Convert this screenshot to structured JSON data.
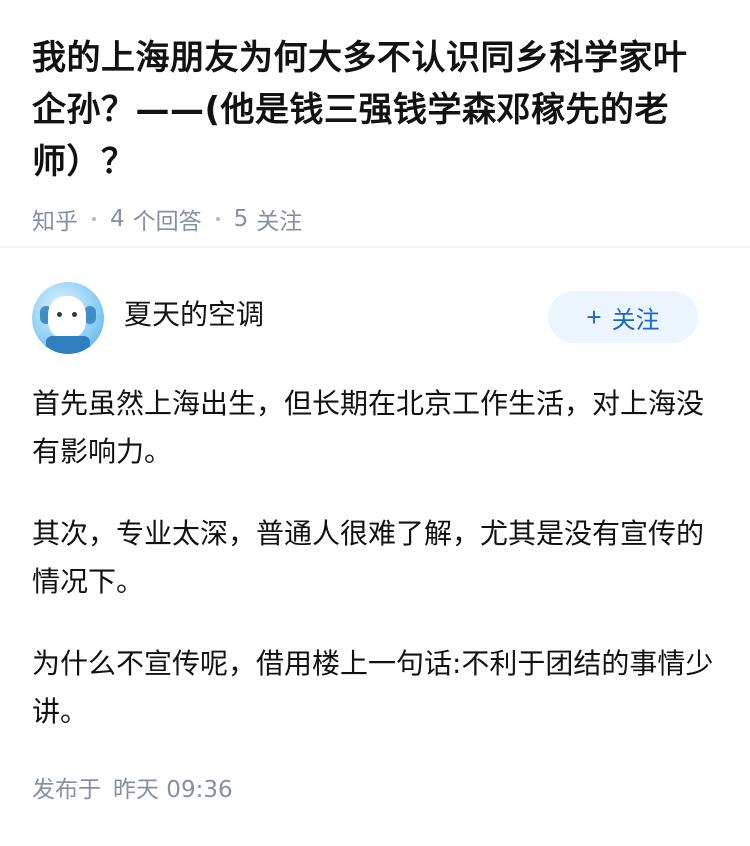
{
  "question": {
    "title": "我的上海朋友为何大多不认识同乡科学家叶企孙？——(他是钱三强钱学森邓稼先的老师）？",
    "source": "知乎",
    "answer_count": "4",
    "answer_unit": "个回答",
    "follow_count": "5",
    "follow_unit": "关注"
  },
  "answer": {
    "author_name": "夏天的空调",
    "follow_button": "关注",
    "follow_plus": "+",
    "paragraphs": [
      "首先虽然上海出生，但长期在北京工作生活，对上海没有影响力。",
      "其次，专业太深，普通人很难了解，尤其是没有宣传的情况下。",
      "为什么不宣传呢，借用楼上一句话:不利于团结的事情少讲。"
    ],
    "publish_label": "发布于",
    "publish_time": "昨天 09:36"
  }
}
